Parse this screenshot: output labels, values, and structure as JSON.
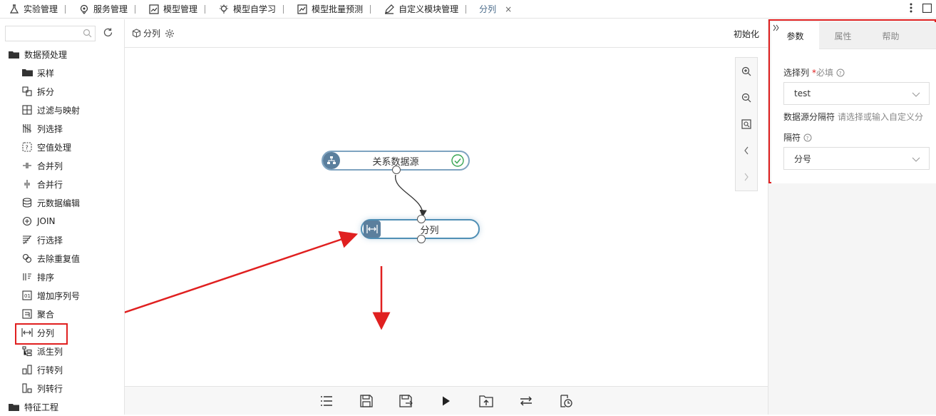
{
  "tabs": [
    {
      "label": "实验管理",
      "icon": "flask-icon"
    },
    {
      "label": "服务管理",
      "icon": "service-icon"
    },
    {
      "label": "模型管理",
      "icon": "chart-icon"
    },
    {
      "label": "模型自学习",
      "icon": "bulb-icon"
    },
    {
      "label": "模型批量预测",
      "icon": "trend-icon"
    },
    {
      "label": "自定义模块管理",
      "icon": "pen-icon"
    },
    {
      "label": "分列",
      "close": "×"
    }
  ],
  "sidebar": {
    "search_placeholder": "",
    "group1": "数据预处理",
    "items": [
      {
        "label": "采样"
      },
      {
        "label": "拆分"
      },
      {
        "label": "过滤与映射"
      },
      {
        "label": "列选择"
      },
      {
        "label": "空值处理"
      },
      {
        "label": "合并列"
      },
      {
        "label": "合并行"
      },
      {
        "label": "元数据编辑"
      },
      {
        "label": "JOIN"
      },
      {
        "label": "行选择"
      },
      {
        "label": "去除重复值"
      },
      {
        "label": "排序"
      },
      {
        "label": "增加序列号"
      },
      {
        "label": "聚合"
      },
      {
        "label": "分列"
      },
      {
        "label": "派生列"
      },
      {
        "label": "行转列"
      },
      {
        "label": "列转行"
      }
    ],
    "group2": "特征工程"
  },
  "canvas": {
    "breadcrumb": "分列",
    "init_label": "初始化",
    "nodes": {
      "source": "关系数据源",
      "split": "分列"
    }
  },
  "right_panel": {
    "tabs": [
      "参数",
      "属性",
      "帮助"
    ],
    "field1_label": "选择列",
    "field1_required_mark": "*",
    "field1_required_text": "必填",
    "field1_value": "test",
    "field2_label": "数据源分隔符",
    "field2_placeholder": "请选择或输入自定义分",
    "field3_label": "隔符",
    "field3_value": "分号"
  },
  "colors": {
    "accent": "#5b7f9d",
    "highlight": "#e02020"
  }
}
